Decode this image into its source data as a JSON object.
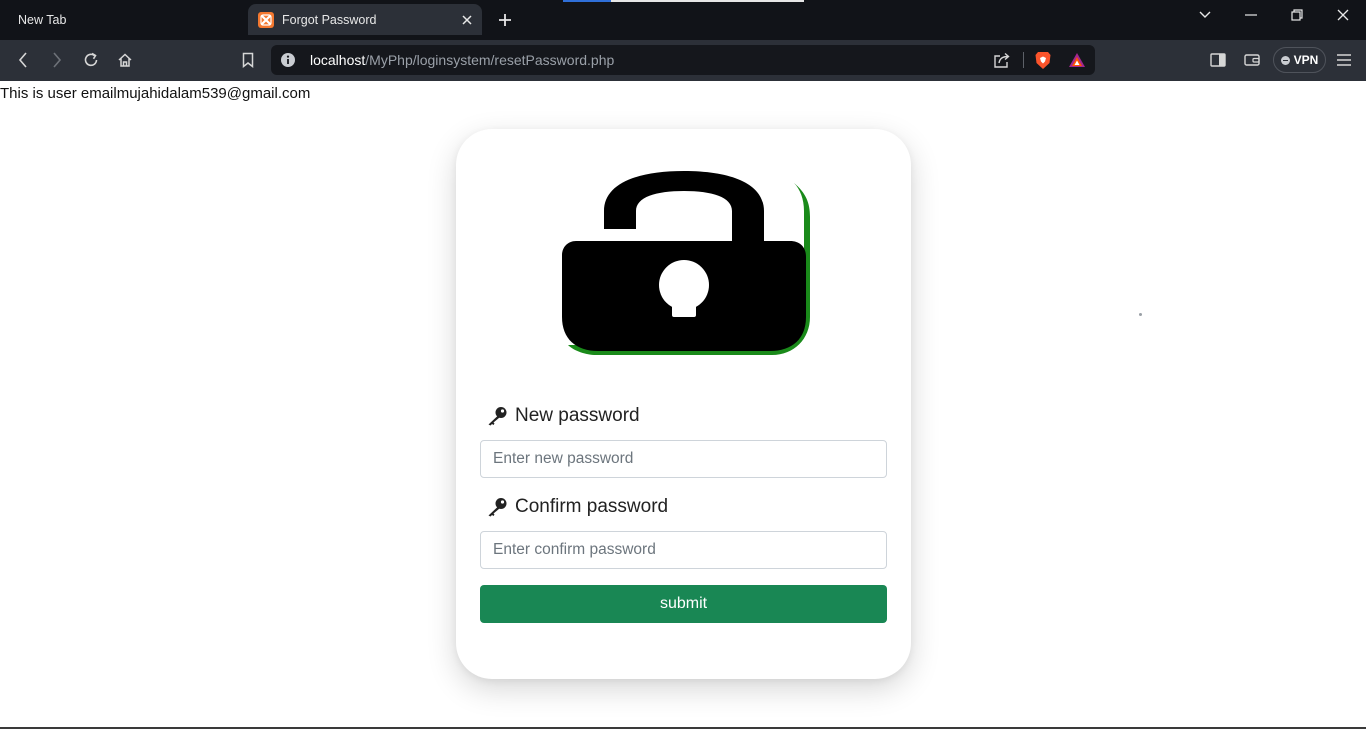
{
  "browser": {
    "tabs": [
      {
        "title": "New Tab",
        "active": false
      },
      {
        "title": "Forgot Password",
        "active": true
      }
    ],
    "url": {
      "host": "localhost",
      "path": "/MyPhp/loginsystem/resetPassword.php"
    },
    "vpn_label": "VPN"
  },
  "page": {
    "user_email_text": "This is user emailmujahidalam539@gmail.com",
    "form": {
      "new_password_label": "New password",
      "new_password_placeholder": "Enter new password",
      "confirm_password_label": "Confirm password",
      "confirm_password_placeholder": "Enter confirm password",
      "submit_label": "submit"
    }
  },
  "colors": {
    "submit_bg": "#198754",
    "lock_accent": "#1a8a1a",
    "chrome_dark": "#111318",
    "toolbar": "#2c3038"
  },
  "icons": [
    "xampp-favicon",
    "lock-open-icon",
    "key-icon",
    "brave-shield-icon",
    "brave-rewards-icon"
  ]
}
